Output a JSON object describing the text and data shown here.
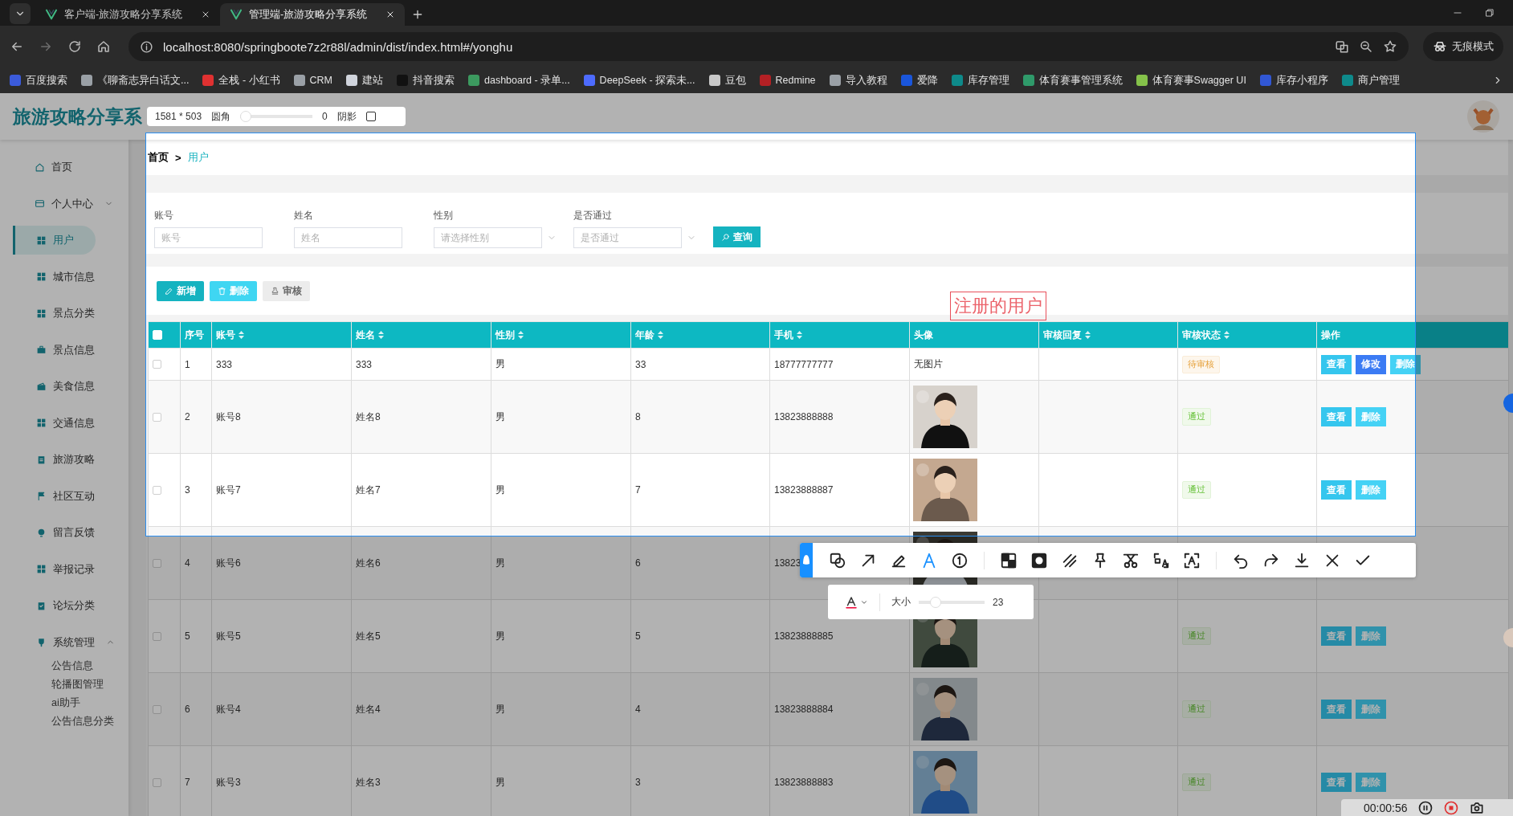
{
  "browser": {
    "tabs": [
      {
        "title": "客户端-旅游攻略分享系统",
        "selected": false
      },
      {
        "title": "管理端-旅游攻略分享系统",
        "selected": true
      }
    ],
    "url": "localhost:8080/springboote7z2r88l/admin/dist/index.html#/yonghu",
    "incognito_label": "无痕模式",
    "bookmarks": [
      {
        "label": "百度搜索",
        "color": "#3b5bdb"
      },
      {
        "label": "《聊斋志异白话文...",
        "color": "#9aa0a6"
      },
      {
        "label": "全栈 - 小红书",
        "color": "#e03131"
      },
      {
        "label": "CRM",
        "color": "#9aa0a6"
      },
      {
        "label": "建站",
        "color": "#d0d4dc"
      },
      {
        "label": "抖音搜索",
        "color": "#111111"
      },
      {
        "label": "dashboard - 录单...",
        "color": "#3c9a5f"
      },
      {
        "label": "DeepSeek - 探索未...",
        "color": "#4d6bfe"
      },
      {
        "label": "豆包",
        "color": "#c8c8c8"
      },
      {
        "label": "Redmine",
        "color": "#b32024"
      },
      {
        "label": "导入教程",
        "color": "#9aa0a6"
      },
      {
        "label": "爱降",
        "color": "#1a56db"
      },
      {
        "label": "库存管理",
        "color": "#0e8a8a"
      },
      {
        "label": "体育赛事管理系统",
        "color": "#2f9a6a"
      },
      {
        "label": "体育赛事Swagger UI",
        "color": "#85c24a"
      },
      {
        "label": "库存小程序",
        "color": "#3157d4"
      },
      {
        "label": "商户管理",
        "color": "#0e8a8b"
      }
    ]
  },
  "app": {
    "title": "旅游攻略分享系"
  },
  "sidebar": {
    "items": [
      {
        "label": "首页",
        "selected": false
      },
      {
        "label": "个人中心",
        "selected": false,
        "expanded": false
      },
      {
        "label": "用户",
        "selected": true
      },
      {
        "label": "城市信息",
        "selected": false
      },
      {
        "label": "景点分类",
        "selected": false
      },
      {
        "label": "景点信息",
        "selected": false
      },
      {
        "label": "美食信息",
        "selected": false
      },
      {
        "label": "交通信息",
        "selected": false
      },
      {
        "label": "旅游攻略",
        "selected": false
      },
      {
        "label": "社区互动",
        "selected": false
      },
      {
        "label": "留言反馈",
        "selected": false
      },
      {
        "label": "举报记录",
        "selected": false
      },
      {
        "label": "论坛分类",
        "selected": false
      },
      {
        "label": "系统管理",
        "selected": false,
        "expanded": true,
        "children": [
          {
            "label": "公告信息",
            "selected": false
          },
          {
            "label": "轮播图管理",
            "selected": false
          },
          {
            "label": "ai助手",
            "selected": false
          },
          {
            "label": "公告信息分类",
            "selected": false
          }
        ]
      }
    ]
  },
  "breadcrumb": {
    "items": [
      {
        "label": "首页",
        "selected": false
      },
      {
        "label": "用户",
        "selected": true
      }
    ],
    "separator": ">"
  },
  "search": {
    "fields": [
      {
        "label": "账号",
        "placeholder": "账号",
        "kind": "input"
      },
      {
        "label": "姓名",
        "placeholder": "姓名",
        "kind": "input"
      },
      {
        "label": "性别",
        "placeholder": "请选择性别",
        "kind": "select"
      },
      {
        "label": "是否通过",
        "placeholder": "是否通过",
        "kind": "select"
      }
    ],
    "button": "查询"
  },
  "actions": [
    {
      "label": "新增",
      "kind": "add"
    },
    {
      "label": "删除",
      "kind": "delete"
    },
    {
      "label": "审核",
      "kind": "audit"
    }
  ],
  "table": {
    "select_all_checked": false,
    "columns": [
      {
        "label": "序号",
        "sortable": false
      },
      {
        "label": "账号",
        "sortable": true
      },
      {
        "label": "姓名",
        "sortable": true
      },
      {
        "label": "性别",
        "sortable": true
      },
      {
        "label": "年龄",
        "sortable": true
      },
      {
        "label": "手机",
        "sortable": true
      },
      {
        "label": "头像",
        "sortable": false
      },
      {
        "label": "审核回复",
        "sortable": true
      },
      {
        "label": "审核状态",
        "sortable": true
      },
      {
        "label": "操作",
        "sortable": false
      }
    ],
    "rows": [
      {
        "checked": false,
        "index": "1",
        "account": "333",
        "name": "333",
        "gender": "男",
        "age": "33",
        "phone": "18777777777",
        "avatar": {
          "kind": "text",
          "text": "无图片"
        },
        "status": {
          "label": "待审核",
          "kind": "pending"
        },
        "actions": [
          {
            "label": "查看",
            "kind": "view"
          },
          {
            "label": "修改",
            "kind": "edit"
          },
          {
            "label": "删除",
            "kind": "delete"
          }
        ]
      },
      {
        "checked": false,
        "index": "2",
        "account": "账号8",
        "name": "姓名8",
        "gender": "男",
        "age": "8",
        "phone": "13823888888",
        "avatar": {
          "kind": "picture"
        },
        "status": {
          "label": "通过",
          "kind": "passed"
        },
        "actions": [
          {
            "label": "查看",
            "kind": "view"
          },
          {
            "label": "删除",
            "kind": "delete"
          }
        ]
      },
      {
        "checked": false,
        "index": "3",
        "account": "账号7",
        "name": "姓名7",
        "gender": "男",
        "age": "7",
        "phone": "13823888887",
        "avatar": {
          "kind": "picture"
        },
        "status": {
          "label": "通过",
          "kind": "passed"
        },
        "actions": [
          {
            "label": "查看",
            "kind": "view"
          },
          {
            "label": "删除",
            "kind": "delete"
          }
        ]
      },
      {
        "checked": false,
        "index": "4",
        "account": "账号6",
        "name": "姓名6",
        "gender": "男",
        "age": "6",
        "phone": "13823",
        "avatar": {
          "kind": "picture"
        }
      },
      {
        "checked": false,
        "index": "5",
        "account": "账号5",
        "name": "姓名5",
        "gender": "男",
        "age": "5",
        "phone": "13823888885",
        "avatar": {
          "kind": "picture"
        },
        "status": {
          "label": "通过",
          "kind": "passed"
        },
        "actions": [
          {
            "label": "查看",
            "kind": "view"
          },
          {
            "label": "删除",
            "kind": "delete"
          }
        ]
      },
      {
        "checked": false,
        "index": "6",
        "account": "账号4",
        "name": "姓名4",
        "gender": "男",
        "age": "4",
        "phone": "13823888884",
        "avatar": {
          "kind": "picture"
        },
        "status": {
          "label": "通过",
          "kind": "passed"
        },
        "actions": [
          {
            "label": "查看",
            "kind": "view"
          },
          {
            "label": "删除",
            "kind": "delete"
          }
        ]
      },
      {
        "checked": false,
        "index": "7",
        "account": "账号3",
        "name": "姓名3",
        "gender": "男",
        "age": "3",
        "phone": "13823888883",
        "avatar": {
          "kind": "picture"
        },
        "status": {
          "label": "通过",
          "kind": "passed"
        },
        "actions": [
          {
            "label": "查看",
            "kind": "view"
          },
          {
            "label": "删除",
            "kind": "delete"
          }
        ]
      }
    ]
  },
  "annotation": {
    "text": "注册的用户"
  },
  "screenshot_tool": {
    "size": "1581 * 503",
    "radius_label": "圆角",
    "radius": {
      "level": 0
    },
    "radius_value": "0",
    "shadow_label": "阴影",
    "shadow_checked": false,
    "tool_groups": [
      [
        {
          "kind": "shape",
          "selected": false
        },
        {
          "kind": "arrow",
          "selected": false
        },
        {
          "kind": "pencil",
          "selected": false
        },
        {
          "kind": "text",
          "selected": true
        },
        {
          "kind": "number",
          "selected": false
        }
      ],
      [
        {
          "kind": "mosaic",
          "selected": false
        },
        {
          "kind": "blur",
          "selected": false
        },
        {
          "kind": "hatch",
          "selected": false
        },
        {
          "kind": "pin",
          "selected": false
        },
        {
          "kind": "scissors",
          "selected": false
        },
        {
          "kind": "translate",
          "selected": false
        },
        {
          "kind": "ocr",
          "selected": false
        }
      ],
      [
        {
          "kind": "undo",
          "selected": false
        },
        {
          "kind": "redo",
          "selected": false
        },
        {
          "kind": "download",
          "selected": false
        },
        {
          "kind": "close",
          "selected": false
        },
        {
          "kind": "confirm",
          "selected": false
        }
      ]
    ],
    "text_panel": {
      "size_label": "大小",
      "level": 0.2,
      "value": "23"
    }
  },
  "recorder": {
    "time": "00:00:56"
  }
}
